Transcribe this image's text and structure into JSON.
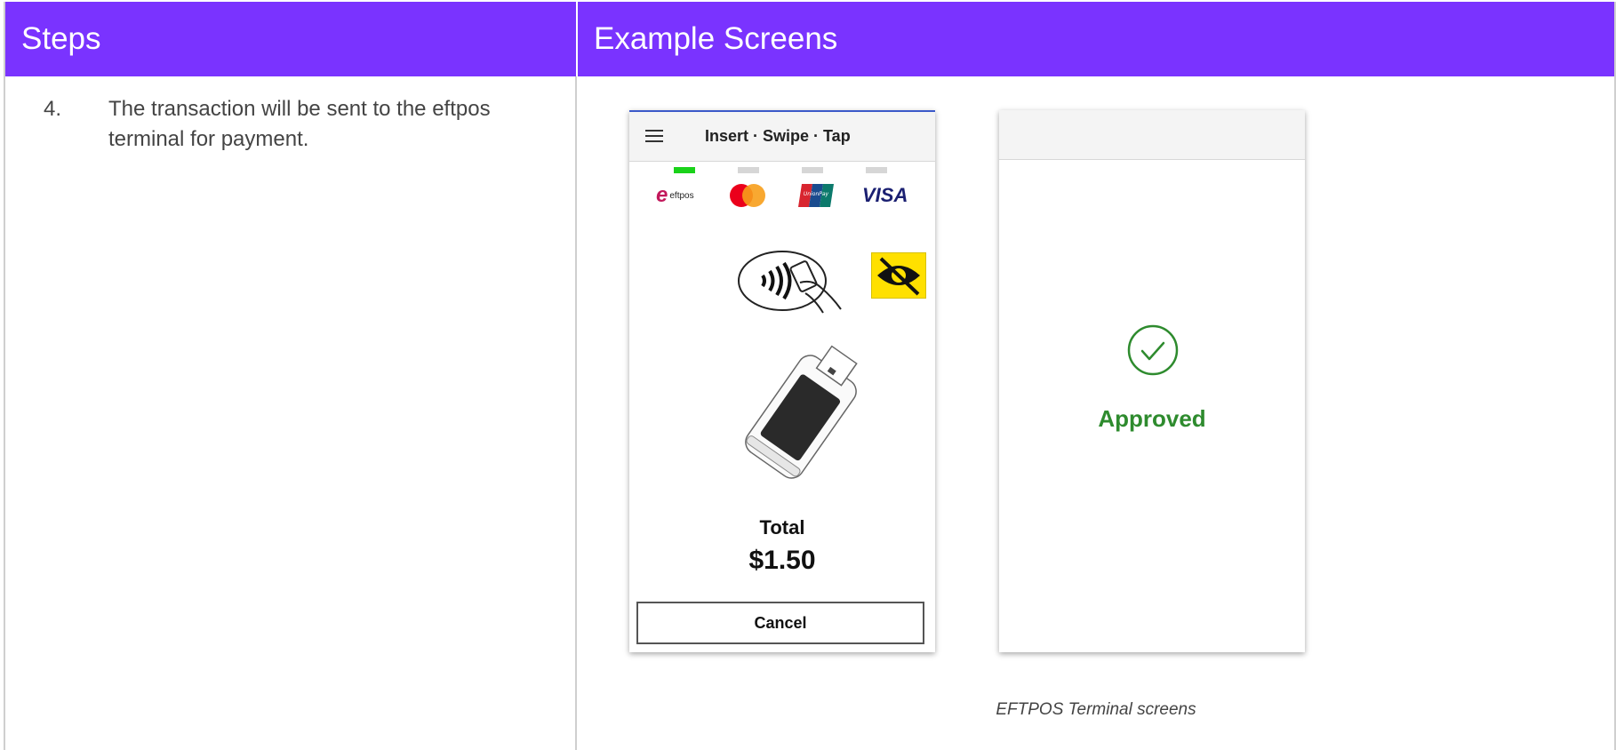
{
  "table": {
    "header_steps": "Steps",
    "header_examples": "Example Screens"
  },
  "step": {
    "number": "4.",
    "text": "The transaction will be sent to the eftpos terminal for payment."
  },
  "screen1": {
    "title": "Insert · Swipe · Tap",
    "brands": {
      "eftpos": "eftpos",
      "visa": "VISA",
      "unionpay": "UnionPay"
    },
    "total_label": "Total",
    "total_amount": "$1.50",
    "cancel_label": "Cancel",
    "active_indicator_color": "#1ad21a"
  },
  "screen2": {
    "status": "Approved",
    "status_color": "#2e8b2e"
  },
  "caption": "EFTPOS Terminal screens",
  "colors": {
    "header_bg": "#7a33ff"
  }
}
